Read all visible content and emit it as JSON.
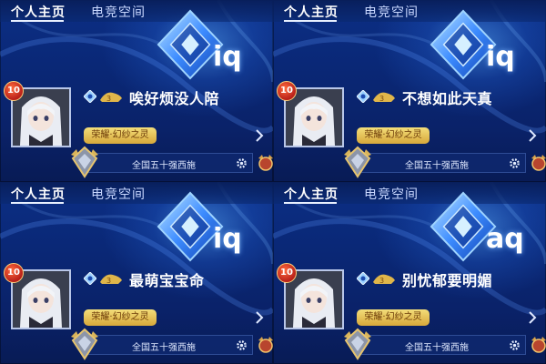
{
  "panels": [
    {
      "tabs": [
        "个人主页",
        "电竞空间"
      ],
      "emblem_text": "iq",
      "level": "10",
      "player_name": "唉好烦没人陪",
      "title_label": "荣耀·幻纱之灵",
      "rank_label": "全国五十强西施"
    },
    {
      "tabs": [
        "个人主页",
        "电竞空间"
      ],
      "emblem_text": "iq",
      "level": "10",
      "player_name": "不想如此天真",
      "title_label": "荣耀·幻纱之灵",
      "rank_label": "全国五十强西施"
    },
    {
      "tabs": [
        "个人主页",
        "电竞空间"
      ],
      "emblem_text": "iq",
      "level": "10",
      "player_name": "最萌宝宝命",
      "title_label": "荣耀·幻纱之灵",
      "rank_label": "全国五十强西施"
    },
    {
      "tabs": [
        "个人主页",
        "电竞空间"
      ],
      "emblem_text": "aq",
      "level": "10",
      "player_name": "别忧郁要明媚",
      "title_label": "荣耀·幻纱之灵",
      "rank_label": "全国五十强西施"
    }
  ],
  "icons": {
    "emblem": "crystal-emblem-icon",
    "vip": "vip-badge-icon",
    "chevron": "chevron-right-icon",
    "gear": "gear-icon",
    "rank": "rank-wing-emblem-icon"
  },
  "colors": {
    "background": "#0a2877",
    "title_pill": "#e9c659",
    "title_text": "#6b3a08",
    "level_badge": "#d8352a",
    "text": "#ffffff"
  }
}
